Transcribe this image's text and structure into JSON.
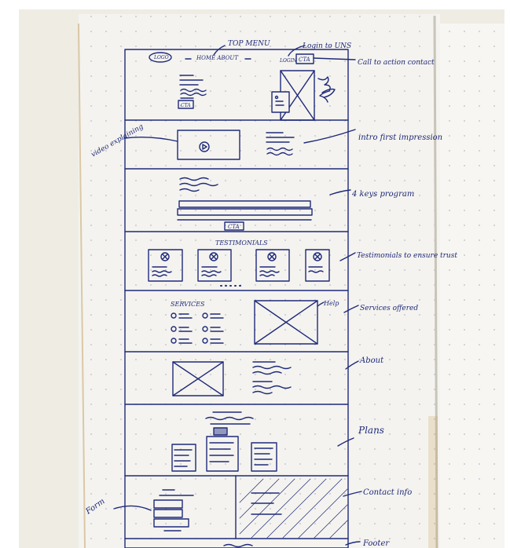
{
  "colors": {
    "ink": "#1f2a7a",
    "paper": "#f4f3ef",
    "paper_shadow": "#d9d7cf",
    "background": "#ffffff",
    "dot": "#b9bcc9",
    "cover": "#b48a3c"
  },
  "sketch": {
    "top": {
      "logo": "LOGO",
      "nav": "HOME  ABOUT",
      "top_menu": "TOP MENU",
      "login": "Login to UNS",
      "login_short": "LOGIN",
      "cta": "CTA",
      "hero_cta": "CTA",
      "call_to_action": "Call to action contact"
    },
    "video": {
      "side_note": "video explaining",
      "intro": "intro first impression"
    },
    "program": {
      "cta": "CTA",
      "note": "4 keys program"
    },
    "testimonials": {
      "heading": "TESTIMONIALS",
      "note": "Testimonials to ensure trust"
    },
    "services": {
      "heading": "SERVICES",
      "help": "Help",
      "note": "Services offered"
    },
    "about": {
      "note": "About"
    },
    "plans": {
      "note": "Plans"
    },
    "contact": {
      "form": "Form",
      "note": "Contact info"
    },
    "footer": {
      "note": "Footer"
    }
  }
}
